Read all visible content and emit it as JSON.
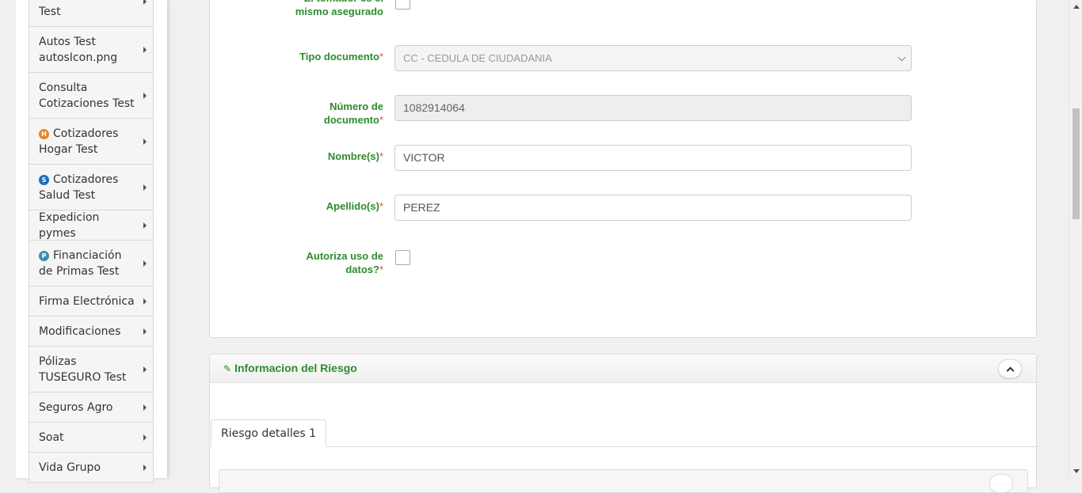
{
  "sidebar": {
    "items": [
      {
        "label": "Test",
        "icon": null
      },
      {
        "label": "Autos Test autosIcon.png",
        "icon": null
      },
      {
        "label": "Consulta Cotizaciones Test",
        "icon": null
      },
      {
        "label": "Cotizadores Hogar Test",
        "icon": "H",
        "icon_color": "#e8842c"
      },
      {
        "label": "Cotizadores Salud Test",
        "icon": "S",
        "icon_color": "#1f6fb5"
      },
      {
        "label": "Expedicion pymes",
        "icon": null
      },
      {
        "label": "Financiación de Primas Test",
        "icon": "P",
        "icon_color": "#3a8ea8"
      },
      {
        "label": "Firma Electrónica",
        "icon": null
      },
      {
        "label": "Modificaciones",
        "icon": null
      },
      {
        "label": "Pólizas TUSEGURO Test",
        "icon": null
      },
      {
        "label": "Seguros Agro",
        "icon": null
      },
      {
        "label": "Soat",
        "icon": null
      },
      {
        "label": "Vida Grupo",
        "icon": null
      }
    ]
  },
  "form": {
    "tomador_label": "El tomador es el mismo asegurado",
    "tipo_documento_label": "Tipo documento",
    "tipo_documento_value": "CC - CEDULA DE CIUDADANIA",
    "numero_documento_label": "Número de documento",
    "numero_documento_value": "1082914064",
    "nombres_label": "Nombre(s)",
    "nombres_value": "VICTOR",
    "apellidos_label": "Apellido(s)",
    "apellidos_value": "PEREZ",
    "autoriza_label": "Autoriza uso de datos?",
    "required_mark": "*"
  },
  "riesgo": {
    "title": "Informacion del Riesgo",
    "tab_label": "Riesgo detalles 1"
  },
  "colors": {
    "label_green": "#2e8b2e",
    "required_red": "#d9534f"
  }
}
